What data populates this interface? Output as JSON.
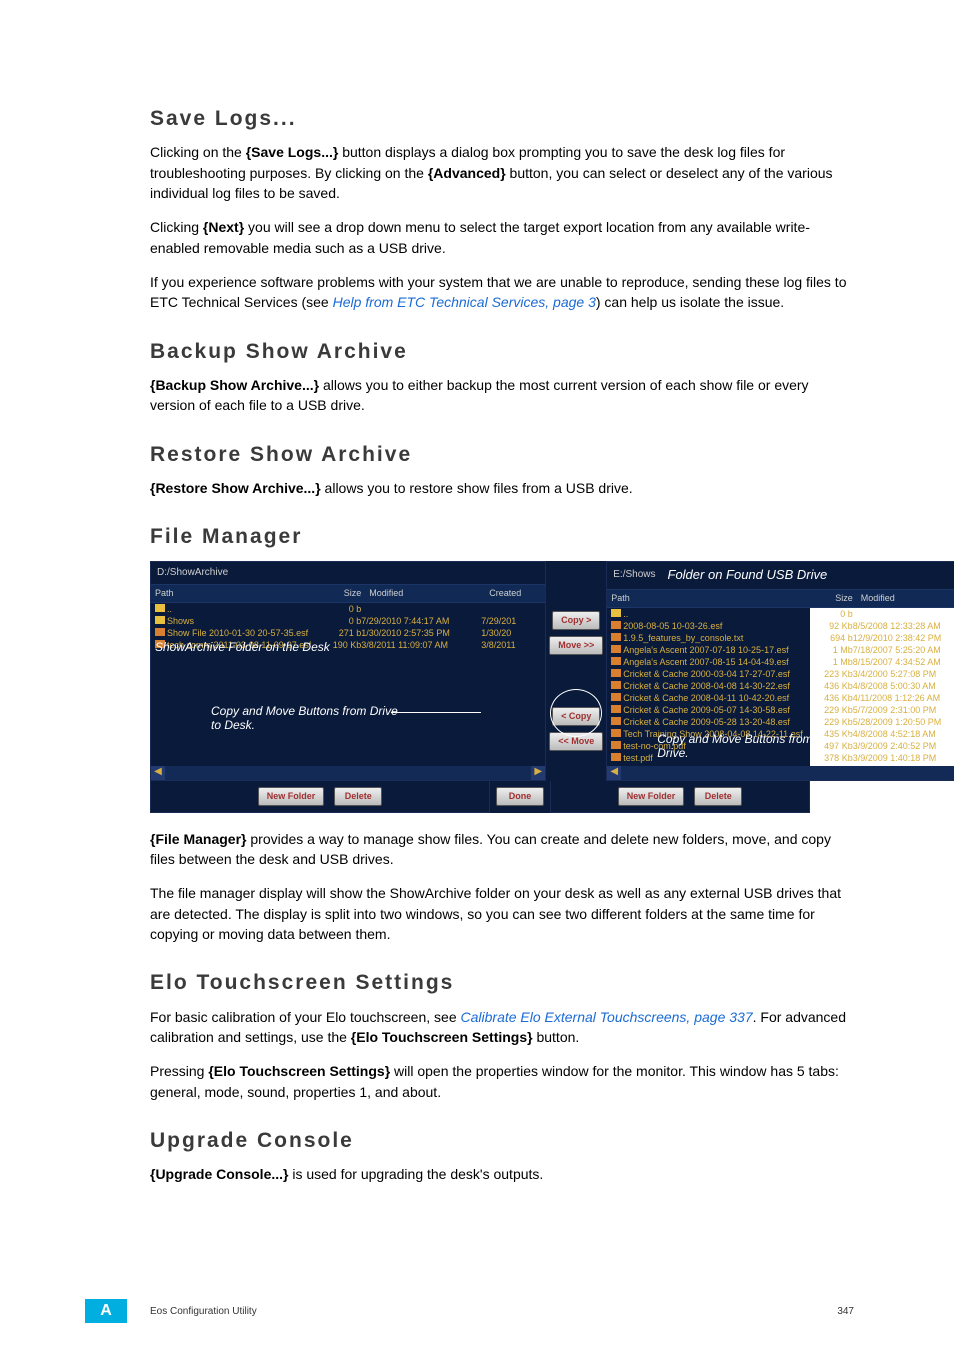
{
  "sections": {
    "save_logs": {
      "heading": "Save Logs...",
      "p1_a": "Clicking on the ",
      "p1_b": "{Save Logs...}",
      "p1_c": " button displays a dialog box prompting you to save the desk log files for troubleshooting purposes. By clicking on the ",
      "p1_d": "{Advanced}",
      "p1_e": " button, you can select or deselect any of the various individual log files to be saved.",
      "p2_a": "Clicking ",
      "p2_b": "{Next}",
      "p2_c": " you will see a drop down menu to select the target export location from any available write-enabled removable media such as a USB drive.",
      "p3_a": "If you experience software problems with your system that we are unable to reproduce, sending these log files to ETC Technical Services (see ",
      "p3_link": "Help from ETC Technical Services, page 3",
      "p3_b": ") can help us isolate the issue."
    },
    "backup": {
      "heading": "Backup Show Archive",
      "p1_a": "{Backup Show Archive...}",
      "p1_b": " allows you to either backup the most current version of each show file or every version of each file to a USB drive."
    },
    "restore": {
      "heading": "Restore Show Archive",
      "p1_a": "{Restore Show Archive...}",
      "p1_b": " allows you to restore show files from a USB drive."
    },
    "filemanager": {
      "heading": "File Manager",
      "p1_a": "{File Manager}",
      "p1_b": " provides a way to manage show files. You can create and delete new folders, move, and copy files between the desk and USB drives.",
      "p2": "The file manager display will show the ShowArchive folder on your desk as well as any external USB drives that are detected. The display is split into two windows, so you can see two different folders at the same time for copying or moving data between them."
    },
    "elo": {
      "heading": "Elo Touchscreen Settings",
      "p1_a": "For basic calibration of your Elo touchscreen, see ",
      "p1_link": "Calibrate Elo External Touchscreens, page 337",
      "p1_b": ". For advanced calibration and settings, use the ",
      "p1_c": "{Elo Touchscreen Settings}",
      "p1_d": " button.",
      "p2_a": "Pressing ",
      "p2_b": "{Elo Touchscreen Settings}",
      "p2_c": " will open the properties window for the monitor. This window has 5 tabs: general, mode, sound, properties 1, and about."
    },
    "upgrade": {
      "heading": "Upgrade Console",
      "p1_a": "{Upgrade Console...}",
      "p1_b": " is used for upgrading the desk's outputs."
    }
  },
  "figure": {
    "left": {
      "path": "D:/ShowArchive",
      "headers": {
        "path": "Path",
        "size": "Size",
        "modified": "Modified",
        "created": "Created"
      },
      "rows": [
        {
          "name": "..",
          "size": "0 b",
          "mod": "",
          "created": ""
        },
        {
          "name": "Shows",
          "size": "0 b",
          "mod": "7/29/2010 7:44:17 AM",
          "created": "7/29/201"
        },
        {
          "name": "Show File 2010-01-30 20-57-35.esf",
          "size": "271 b",
          "mod": "1/30/2010 2:57:35 PM",
          "created": "1/30/20"
        },
        {
          "name": "tech comm 2011-03-08 11-09-07.esf",
          "size": "190 Kb",
          "mod": "3/8/2011 11:09:07 AM",
          "created": "3/8/2011"
        }
      ],
      "annot1": "ShowArchive Folder on the Desk",
      "annot2": "Copy and Move Buttons from Drive to Desk."
    },
    "right": {
      "path": "E:/Shows",
      "caption": "Folder on Found USB Drive",
      "headers": {
        "path": "Path",
        "size": "Size",
        "modified": "Modified"
      },
      "rows": [
        {
          "name": "..",
          "size": "0 b",
          "mod": ""
        },
        {
          "name": "2008-08-05 10-03-26.esf",
          "size": "92 Kb",
          "mod": "8/5/2008 12:33:28 AM"
        },
        {
          "name": "1.9.5_features_by_console.txt",
          "size": "694 b",
          "mod": "12/9/2010 2:38:42 PM"
        },
        {
          "name": "Angela's Ascent 2007-07-18 10-25-17.esf",
          "size": "1 Mb",
          "mod": "7/18/2007 5:25:20 AM"
        },
        {
          "name": "Angela's Ascent 2007-08-15 14-04-49.esf",
          "size": "1 Mb",
          "mod": "8/15/2007 4:34:52 AM"
        },
        {
          "name": "Cricket & Cache 2000-03-04 17-27-07.esf",
          "size": "223 Kb",
          "mod": "3/4/2000 5:27:08 PM"
        },
        {
          "name": "Cricket & Cache 2008-04-08 14-30-22.esf",
          "size": "436 Kb",
          "mod": "4/8/2008 5:00:30 AM"
        },
        {
          "name": "Cricket & Cache 2008-04-11 10-42-20.esf",
          "size": "436 Kb",
          "mod": "4/11/2008 1:12:26 AM"
        },
        {
          "name": "Cricket & Cache 2009-05-07 14-30-58.esf",
          "size": "229 Kb",
          "mod": "5/7/2009 2:31:00 PM"
        },
        {
          "name": "Cricket & Cache 2009-05-28 13-20-48.esf",
          "size": "229 Kb",
          "mod": "5/28/2009 1:20:50 PM"
        },
        {
          "name": "Tech Training Show 2008-04-08 14-22-11.esf",
          "size": "435 Kb",
          "mod": "4/8/2008 4:52:18 AM"
        },
        {
          "name": "test-no-com.pdf",
          "size": "497 Kb",
          "mod": "3/9/2009 2:40:52 PM"
        },
        {
          "name": "test.pdf",
          "size": "378 Kb",
          "mod": "3/9/2009 1:40:18 PM"
        }
      ],
      "annot": "Copy and Move Buttons from Desk to Drive."
    },
    "buttons": {
      "copy_r": "Copy >",
      "move_r": "Move >>",
      "copy_l": "< Copy",
      "move_l": "<< Move",
      "new_folder": "New Folder",
      "delete": "Delete",
      "done": "Done"
    }
  },
  "footer": {
    "badge": "A",
    "title": "Eos Configuration Utility",
    "page": "347"
  }
}
